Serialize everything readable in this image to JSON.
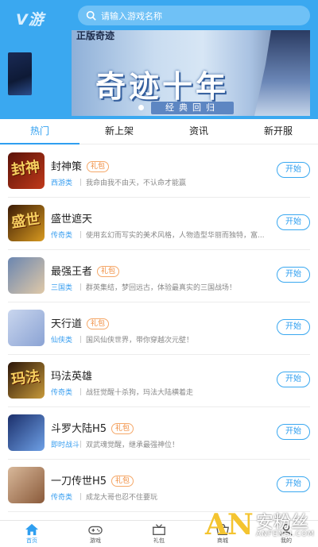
{
  "header": {
    "logo": "V游",
    "search_placeholder": "请输入游戏名称"
  },
  "banner": {
    "corner_text": "正版奇迹",
    "title": "奇迹十年",
    "subtitle": "经典回归"
  },
  "tabs": [
    {
      "label": "热门",
      "active": true
    },
    {
      "label": "新上架",
      "active": false
    },
    {
      "label": "资讯",
      "active": false
    },
    {
      "label": "新开服",
      "active": false
    }
  ],
  "games": [
    {
      "name": "封神策",
      "badge": "礼包",
      "category": "西游类",
      "desc": "我命由我不由天，不认命才能赢",
      "button": "开始",
      "thumb_text": "封神",
      "thumb_colors": [
        "#5a1208",
        "#c0391a"
      ]
    },
    {
      "name": "盛世遮天",
      "badge": "",
      "category": "传奇类",
      "desc": "使用玄幻而写实的美术风格，人物造型华丽而独特，富...",
      "button": "开始",
      "thumb_text": "盛世",
      "thumb_colors": [
        "#3a1a05",
        "#d89a20"
      ]
    },
    {
      "name": "最强王者",
      "badge": "礼包",
      "category": "三国类",
      "desc": "群英集结，梦回远古，体验最真实的三国战场！",
      "button": "开始",
      "thumb_text": "",
      "thumb_colors": [
        "#6b86b0",
        "#e0c9a8"
      ]
    },
    {
      "name": "天行道",
      "badge": "礼包",
      "category": "仙侠类",
      "desc": "国风仙侠世界，带你穿越次元壁！",
      "button": "开始",
      "thumb_text": "",
      "thumb_colors": [
        "#c9d6ee",
        "#8ba3d4"
      ]
    },
    {
      "name": "玛法英雄",
      "badge": "",
      "category": "传奇类",
      "desc": "战狂觉醒十杀狗，玛法大陆横着走",
      "button": "开始",
      "thumb_text": "玛法",
      "thumb_colors": [
        "#2a1508",
        "#c89a3a"
      ]
    },
    {
      "name": "斗罗大陆H5",
      "badge": "礼包",
      "category": "即时战斗",
      "desc": "双武魂觉醒，继承最强神位！",
      "button": "开始",
      "thumb_text": "",
      "thumb_colors": [
        "#1b2f6b",
        "#6ea0e6"
      ]
    },
    {
      "name": "一刀传世H5",
      "badge": "礼包",
      "category": "传奇类",
      "desc": "成龙大哥也忍不住要玩",
      "button": "开始",
      "thumb_text": "",
      "thumb_colors": [
        "#d8b89a",
        "#8a5a3a"
      ]
    }
  ],
  "bottom_nav": [
    {
      "label": "首页",
      "icon": "home-icon",
      "active": true
    },
    {
      "label": "游戏",
      "icon": "gamepad-icon",
      "active": false
    },
    {
      "label": "礼包",
      "icon": "gift-icon",
      "active": false
    },
    {
      "label": "商城",
      "icon": "shop-icon",
      "active": false
    },
    {
      "label": "我的",
      "icon": "user-icon",
      "active": false
    }
  ],
  "watermark": {
    "logo": "AN",
    "text": "安粉丝",
    "url": "ANFENSI.COM"
  },
  "colors": {
    "primary": "#3aa8f0",
    "accent_text": "#2f9ff0",
    "badge": "#f08a3a"
  }
}
